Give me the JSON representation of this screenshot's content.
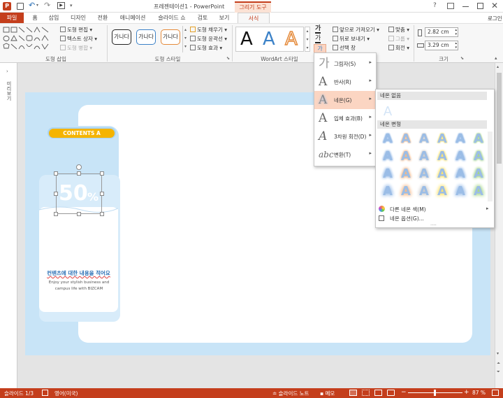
{
  "window": {
    "title": "프레젠테이션1 - PowerPoint",
    "contextual": "그리기 도구",
    "help": "?",
    "login": "로그인"
  },
  "tabs": [
    "파일",
    "홈",
    "삽입",
    "디자인",
    "전환",
    "애니메이션",
    "슬라이드 쇼",
    "검토",
    "보기",
    "서식"
  ],
  "ribbon": {
    "groups": [
      "도형 삽입",
      "도형 스타일",
      "WordArt 스타일",
      "크기"
    ],
    "insert_shape": [
      "도형 편집",
      "텍스트 상자",
      "도형 병합"
    ],
    "style_presets": [
      "가나다",
      "가나다",
      "가나다"
    ],
    "fill_cmds": [
      "도형 채우기",
      "도형 윤곽선",
      "도형 효과"
    ],
    "wordart_letter": "A",
    "arrange": [
      "앞으로 가져오기",
      "뒤로 보내기",
      "선택 창"
    ],
    "align": [
      "맞춤",
      "그룹",
      "회전"
    ],
    "size_height": "2.82 cm",
    "size_width": "3.29 cm"
  },
  "slide": {
    "badge": "CONTENTS A",
    "big_number": "50",
    "percent": "%",
    "heading": "컨텐츠에 대한 내용을 적어요",
    "body": "Enjoy your stylish business and campus life with BIZCAM"
  },
  "left_pane_label": "미리보기",
  "menu": {
    "items": [
      {
        "icon": "가",
        "label": "그림자(S)"
      },
      {
        "icon": "A",
        "label": "반사(R)"
      },
      {
        "icon": "A",
        "label": "네온(G)"
      },
      {
        "icon": "A",
        "label": "입체 효과(B)"
      },
      {
        "icon": "A",
        "label": "3차원 회전(D)"
      },
      {
        "icon": "abc",
        "label": "변환(T)"
      }
    ]
  },
  "submenu": {
    "section_none": "네온 없음",
    "section_variants": "네온 변형",
    "letter": "A",
    "more_colors": "다른 네온 색(M)",
    "options": "네온 옵션(G)...",
    "grip": "....",
    "glow_colors": [
      "#8fb6e6",
      "#f2b07a",
      "#c7c7c7",
      "#ffe15a",
      "#8fb6e6",
      "#9bd27a"
    ]
  },
  "status": {
    "slide": "슬라이드 1/3",
    "language": "영어(미국)",
    "notes": "슬라이드 노트",
    "comments": "메모",
    "zoom": "87 %"
  },
  "colors": {
    "accent": "#c43e1c",
    "menu_highlight": "#fbd5c2",
    "badge": "#f5b400",
    "slide_bg": "#c8e4f7",
    "blue": "#2a6fb5"
  }
}
